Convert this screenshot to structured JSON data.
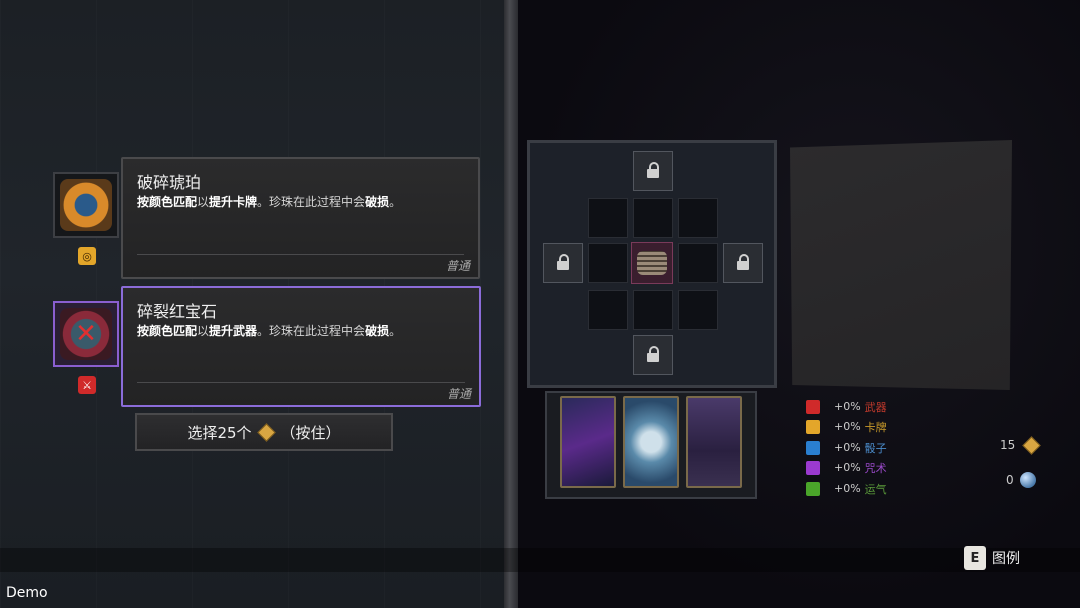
{
  "gems": [
    {
      "title": "破碎琥珀",
      "desc_parts": [
        "按颜色匹配",
        "以",
        "提升卡牌",
        "。珍珠在此过程中会",
        "破损",
        "。"
      ],
      "rarity": "普通",
      "gem_color": "#d98a2a",
      "badge_color": "#e3a62a",
      "badge_symbol": "◎",
      "icon": "broken-amber-icon",
      "selected": false
    },
    {
      "title": "碎裂红宝石",
      "desc_parts": [
        "按颜色匹配",
        "以",
        "提升武器",
        "。珍珠在此过程中会",
        "破损",
        "。"
      ],
      "rarity": "普通",
      "gem_color": "#c0304a",
      "badge_color": "#d02a2a",
      "badge_symbol": "⚔",
      "icon": "cracked-ruby-icon",
      "selected": true
    }
  ],
  "select_button": {
    "prefix": "选择25个",
    "suffix": "（按住）"
  },
  "stats": [
    {
      "value": "+0%",
      "label": "武器",
      "color": "#d02a2a",
      "label_color": "#c0392b",
      "icon": "weapon-stat-icon"
    },
    {
      "value": "+0%",
      "label": "卡牌",
      "color": "#e3a62a",
      "label_color": "#c99a2a",
      "icon": "card-stat-icon"
    },
    {
      "value": "+0%",
      "label": "骰子",
      "color": "#2a7fd0",
      "label_color": "#4a8ac9",
      "icon": "dice-stat-icon"
    },
    {
      "value": "+0%",
      "label": "咒术",
      "color": "#9b3ad0",
      "label_color": "#9a4ac9",
      "icon": "curse-stat-icon"
    },
    {
      "value": "+0%",
      "label": "运气",
      "color": "#4aa52a",
      "label_color": "#5a9a3a",
      "icon": "luck-stat-icon"
    }
  ],
  "currency": {
    "gold": "15",
    "pearls": "0"
  },
  "legend": {
    "key": "E",
    "label": "图例"
  },
  "demo_label": "Demo",
  "colors": {
    "accent_purple": "#8b6cd9",
    "background": "#0a0a0f"
  }
}
